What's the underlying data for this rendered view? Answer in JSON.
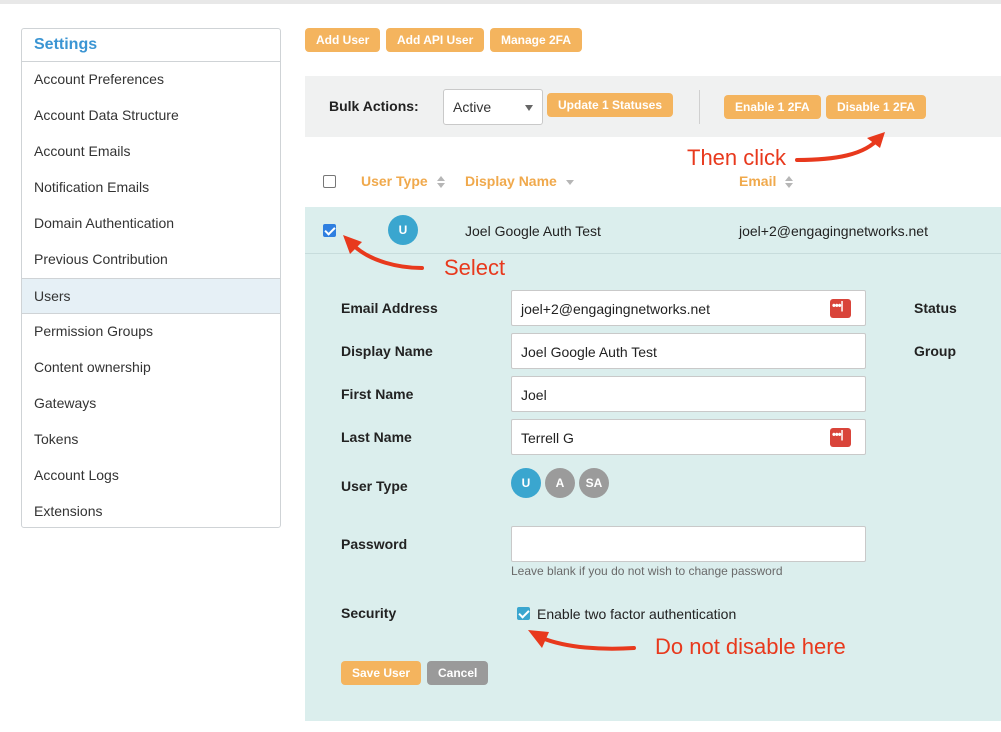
{
  "colors": {
    "accent": "#f4b45e",
    "link": "#3b95d3",
    "panel": "#dbeeed",
    "annotation": "#e8391d"
  },
  "sidebar": {
    "title": "Settings",
    "items": [
      {
        "label": "Account Preferences"
      },
      {
        "label": "Account Data Structure"
      },
      {
        "label": "Account Emails"
      },
      {
        "label": "Notification Emails"
      },
      {
        "label": "Domain Authentication"
      },
      {
        "label": "Previous Contribution"
      },
      {
        "label": "Users"
      },
      {
        "label": "Permission Groups"
      },
      {
        "label": "Content ownership"
      },
      {
        "label": "Gateways"
      },
      {
        "label": "Tokens"
      },
      {
        "label": "Account Logs"
      },
      {
        "label": "Extensions"
      }
    ],
    "active_index": 6
  },
  "toolbar": {
    "add_user": "Add User",
    "add_api_user": "Add API User",
    "manage_2fa": "Manage 2FA"
  },
  "bulk": {
    "label": "Bulk Actions:",
    "status_select": "Active",
    "update_button": "Update 1 Statuses",
    "enable_2fa": "Enable 1 2FA",
    "disable_2fa": "Disable 1 2FA"
  },
  "table": {
    "headers": {
      "user_type": "User Type",
      "display_name": "Display Name",
      "email": "Email"
    },
    "row": {
      "type_badge": "U",
      "display_name": "Joel Google Auth Test",
      "email": "joel+2@engagingnetworks.net",
      "selected": true
    }
  },
  "form": {
    "email_label": "Email Address",
    "email_value": "joel+2@engagingnetworks.net",
    "display_label": "Display Name",
    "display_value": "Joel Google Auth Test",
    "first_label": "First Name",
    "first_value": "Joel",
    "last_label": "Last Name",
    "last_value": "Terrell G",
    "user_type_label": "User Type",
    "user_types": [
      "U",
      "A",
      "SA"
    ],
    "password_label": "Password",
    "password_hint": "Leave blank if you do not wish to change password",
    "security_label": "Security",
    "two_factor_label": "Enable two factor authentication",
    "two_factor_checked": true,
    "status_label": "Status",
    "group_label": "Group",
    "save": "Save User",
    "cancel": "Cancel"
  },
  "annotations": {
    "then_click": "Then click",
    "select": "Select",
    "do_not_disable": "Do not disable here"
  }
}
